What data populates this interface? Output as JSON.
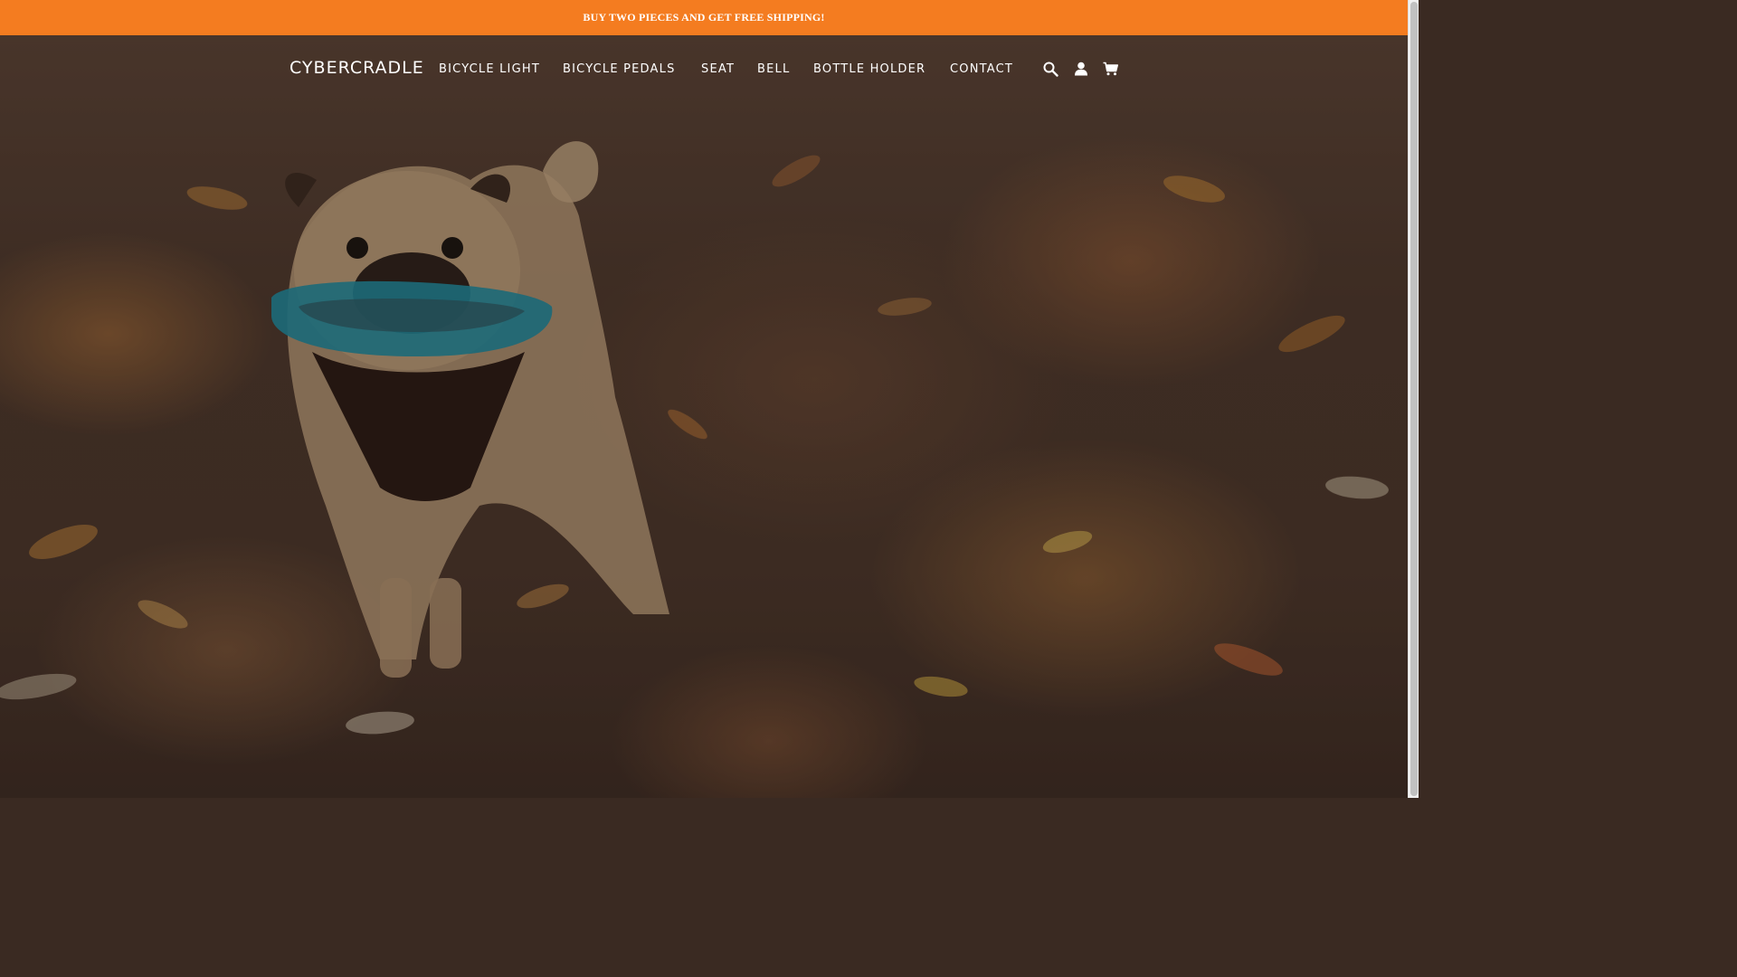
{
  "announcement": {
    "text": "BUY TWO PIECES AND GET FREE SHIPPING!",
    "background": "#f47c20"
  },
  "header": {
    "logo": "CYBERCRADLE",
    "nav": [
      {
        "label": "BICYCLE LIGHT"
      },
      {
        "label": "BICYCLE PEDALS"
      },
      {
        "label": "SEAT"
      },
      {
        "label": "BELL"
      },
      {
        "label": "BOTTLE HOLDER"
      },
      {
        "label": "CONTACT"
      }
    ],
    "icons": [
      "search-icon",
      "account-icon",
      "cart-icon"
    ]
  },
  "hero": {
    "image": "pug-with-blue-frisbee-on-autumn-leaves"
  }
}
